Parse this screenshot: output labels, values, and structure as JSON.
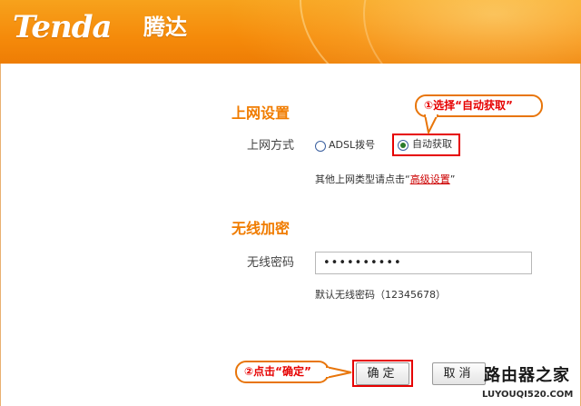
{
  "header": {
    "logo_text": "Tenda",
    "logo_cn": "腾达"
  },
  "internet": {
    "title": "上网设置",
    "mode_label": "上网方式",
    "options": [
      {
        "label": "ADSL拨号",
        "checked": false
      },
      {
        "label": "自动获取",
        "checked": true
      }
    ],
    "advanced_prefix": "其他上网类型请点击“",
    "advanced_link": "高级设置",
    "advanced_suffix": "”"
  },
  "wireless": {
    "title": "无线加密",
    "password_label": "无线密码",
    "password_value": "••••••••••",
    "default_hint": "默认无线密码（12345678）"
  },
  "buttons": {
    "ok": "确定",
    "cancel": "取消"
  },
  "annotations": {
    "step1": "①选择“自动获取”",
    "step2": "②点击“确定”"
  },
  "watermark": {
    "title": "路由器之家",
    "url": "LUYOUQI520.COM"
  },
  "colors": {
    "header_orange": "#f58a0a",
    "section_title": "#f07c00",
    "highlight_red": "#e60000"
  }
}
